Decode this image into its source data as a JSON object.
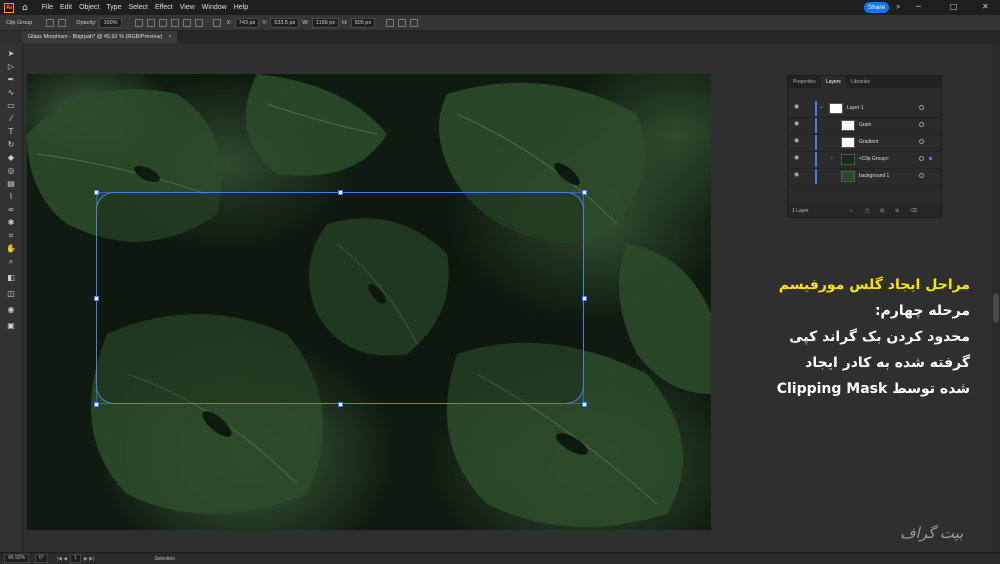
{
  "app": {
    "logo": "Ai",
    "menu": [
      "File",
      "Edit",
      "Object",
      "Type",
      "Select",
      "Effect",
      "View",
      "Window",
      "Help"
    ],
    "share_label": "Share"
  },
  "control_bar": {
    "selection_type": "Clip Group",
    "opacity_label": "Opacity:",
    "opacity_value": "100%",
    "x_label": "X:",
    "x_value": "743 px",
    "y_label": "Y:",
    "y_value": "533.5 px",
    "w_label": "W:",
    "w_value": "1156 px",
    "h_label": "H:",
    "h_value": "505 px"
  },
  "document": {
    "tab_title": "Glass Morphism - Bitgrpah* @ 45.92 % (RGB/Preview)",
    "close": "×"
  },
  "layers_panel": {
    "tabs": [
      "Properties",
      "Layers",
      "Libraries"
    ],
    "active_tab": "Layers",
    "rows": [
      {
        "name": "Layer 1",
        "indent": 0,
        "expander": "⌄"
      },
      {
        "name": "Grain",
        "indent": 1,
        "expander": ""
      },
      {
        "name": "Gradient",
        "indent": 1,
        "expander": ""
      },
      {
        "name": "<Clip Group>",
        "indent": 1,
        "expander": "›"
      },
      {
        "name": "background 1",
        "indent": 1,
        "expander": ""
      }
    ],
    "footer": "1 Layer"
  },
  "caption": {
    "headline": "مراحل ایجاد گلس مورفیسم",
    "step": "مرحله چهارم:",
    "line1": "محدود کردن بک گراند کپی",
    "line2": "گرفته شده به کادر ایجاد",
    "line3": "شده توسط Clipping Mask"
  },
  "status_bar": {
    "zoom": "45.92%",
    "rotation": "0°",
    "artboard": "1",
    "tool": "Selection"
  },
  "watermark": "بیت گراف",
  "colors": {
    "accent": "#1473e6",
    "selection": "#4a7de0",
    "highlight_text": "#f7e600"
  }
}
